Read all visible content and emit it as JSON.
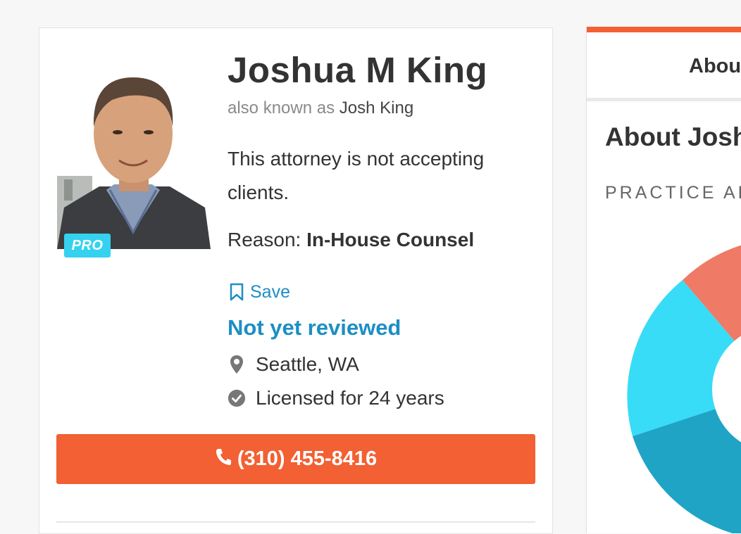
{
  "profile": {
    "name": "Joshua M King",
    "aka_prefix": "also known as",
    "aka_name": "Josh King",
    "accepting_text": "This attorney is not accepting clients.",
    "reason_label": "Reason:",
    "reason_value": "In-House Counsel",
    "pro_badge": "PRO",
    "save_label": "Save",
    "reviews_label": "Not yet reviewed",
    "location": "Seattle, WA",
    "licensed": "Licensed for 24 years",
    "phone": "(310) 455-8416",
    "icons": {
      "save": "bookmark-icon",
      "location": "map-pin-icon",
      "licensed": "check-circle-icon",
      "phone": "phone-icon"
    }
  },
  "sidebar": {
    "tab_label": "Abou",
    "heading": "About Josh",
    "practice_label": "PRACTICE AR"
  },
  "colors": {
    "accent_orange": "#f26033",
    "link_blue": "#1d8ec4",
    "pro_cyan": "#34d2ef",
    "chart_salmon": "#ef7a66",
    "chart_cyan": "#38dcf6",
    "chart_teal": "#1fa4c6"
  }
}
